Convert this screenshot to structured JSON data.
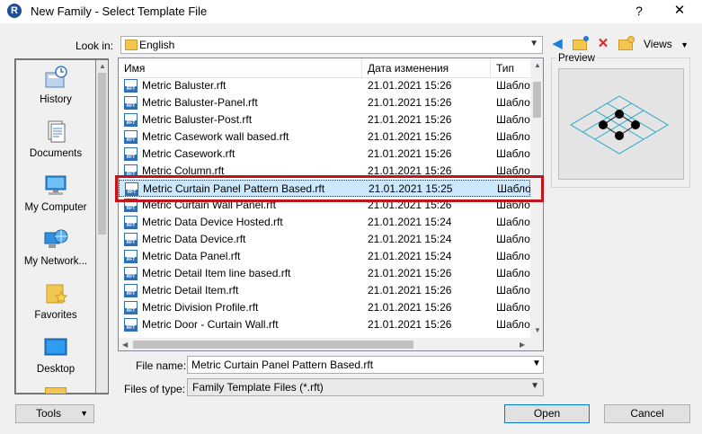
{
  "window": {
    "title": "New Family - Select Template File",
    "help": "?",
    "close": "✕",
    "app_icon": "R"
  },
  "look_in": {
    "label": "Look in:",
    "value": "English"
  },
  "toolbar": {
    "views_label": "Views"
  },
  "places": [
    {
      "label": "History",
      "icon": "history-icon"
    },
    {
      "label": "Documents",
      "icon": "documents-icon"
    },
    {
      "label": "My Computer",
      "icon": "computer-icon"
    },
    {
      "label": "My Network...",
      "icon": "network-icon"
    },
    {
      "label": "Favorites",
      "icon": "favorites-icon"
    },
    {
      "label": "Desktop",
      "icon": "desktop-icon"
    }
  ],
  "columns": {
    "name": "Имя",
    "date": "Дата изменения",
    "type": "Тип"
  },
  "files": [
    {
      "name": "Metric Baluster.rft",
      "date": "21.01.2021 15:26",
      "type": "Шаблон"
    },
    {
      "name": "Metric Baluster-Panel.rft",
      "date": "21.01.2021 15:26",
      "type": "Шаблон"
    },
    {
      "name": "Metric Baluster-Post.rft",
      "date": "21.01.2021 15:26",
      "type": "Шаблон"
    },
    {
      "name": "Metric Casework wall based.rft",
      "date": "21.01.2021 15:26",
      "type": "Шаблон"
    },
    {
      "name": "Metric Casework.rft",
      "date": "21.01.2021 15:26",
      "type": "Шаблон"
    },
    {
      "name": "Metric Column.rft",
      "date": "21.01.2021 15:26",
      "type": "Шаблон"
    },
    {
      "name": "Metric Curtain Panel Pattern Based.rft",
      "date": "21.01.2021 15:25",
      "type": "Шаблон",
      "selected": true
    },
    {
      "name": "Metric Curtain Wall Panel.rft",
      "date": "21.01.2021 15:26",
      "type": "Шаблон"
    },
    {
      "name": "Metric Data Device Hosted.rft",
      "date": "21.01.2021 15:24",
      "type": "Шаблон"
    },
    {
      "name": "Metric Data Device.rft",
      "date": "21.01.2021 15:24",
      "type": "Шаблон"
    },
    {
      "name": "Metric Data Panel.rft",
      "date": "21.01.2021 15:24",
      "type": "Шаблон"
    },
    {
      "name": "Metric Detail Item line based.rft",
      "date": "21.01.2021 15:26",
      "type": "Шаблон"
    },
    {
      "name": "Metric Detail Item.rft",
      "date": "21.01.2021 15:26",
      "type": "Шаблон"
    },
    {
      "name": "Metric Division Profile.rft",
      "date": "21.01.2021 15:26",
      "type": "Шаблон"
    },
    {
      "name": "Metric Door - Curtain Wall.rft",
      "date": "21.01.2021 15:26",
      "type": "Шаблон"
    }
  ],
  "preview": {
    "label": "Preview"
  },
  "file_name": {
    "label": "File name:",
    "value": "Metric Curtain Panel Pattern Based.rft"
  },
  "file_type": {
    "label": "Files of type:",
    "value": "Family Template Files  (*.rft)"
  },
  "buttons": {
    "tools": "Tools",
    "open": "Open",
    "cancel": "Cancel"
  },
  "colors": {
    "highlight": "#c3141b",
    "selection": "#cce8ff",
    "accent": "#0078d7"
  }
}
